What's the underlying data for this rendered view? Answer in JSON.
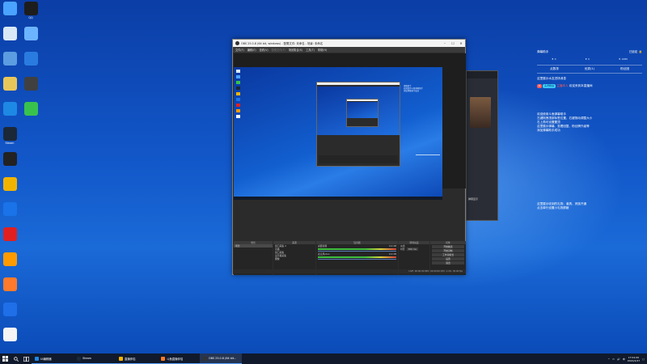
{
  "desktop": {
    "icons": [
      {
        "label": "",
        "icon": "computer-icon",
        "color": "#4aa3ff"
      },
      {
        "label": "QQ",
        "icon": "qq-icon",
        "color": "#1d1d1d"
      },
      {
        "label": "",
        "icon": "recycle-bin-icon",
        "color": "#d9e8f6"
      },
      {
        "label": "",
        "icon": "control-panel-icon",
        "color": "#6bb4ff"
      },
      {
        "label": "",
        "icon": "network-icon",
        "color": "#5b9de0"
      },
      {
        "label": "",
        "icon": "app-icon",
        "color": "#2a7be0"
      },
      {
        "label": "",
        "icon": "folder-icon",
        "color": "#e8c75a"
      },
      {
        "label": "",
        "icon": "media-icon",
        "color": "#404040"
      },
      {
        "label": "",
        "icon": "ie-icon",
        "color": "#1e88e5"
      },
      {
        "label": "",
        "icon": "wechat-icon",
        "color": "#39c14e"
      },
      {
        "label": "Steam",
        "icon": "steam-icon",
        "color": "#1b2838"
      },
      {
        "label": "",
        "icon": "obs-icon",
        "color": "#222222"
      },
      {
        "label": "",
        "icon": "game-icon",
        "color": "#f0b400"
      },
      {
        "label": "",
        "icon": "chrome-icon",
        "color": "#1a73e8"
      },
      {
        "label": "",
        "icon": "netease-music-icon",
        "color": "#e02020"
      },
      {
        "label": "",
        "icon": "huya-icon",
        "color": "#ff9a00"
      },
      {
        "label": "",
        "icon": "douyu-icon",
        "color": "#ff7a2a"
      },
      {
        "label": "",
        "icon": "kugou-icon",
        "color": "#1f6fe8"
      },
      {
        "label": "",
        "icon": "file-icon",
        "color": "#f5f5f5"
      }
    ]
  },
  "obs": {
    "title": "OBS 25.0.8 (64 bit, windows) - 配置文件: 未命名 - 场景: 未命名",
    "menu": [
      {
        "label": "文件(F)",
        "disabled": false
      },
      {
        "label": "编辑(E)",
        "disabled": false
      },
      {
        "label": "查看(V)",
        "disabled": false
      },
      {
        "label": "配置文件(P)",
        "disabled": true
      },
      {
        "label": "场景集合(S)",
        "disabled": false
      },
      {
        "label": "工具(T)",
        "disabled": false
      },
      {
        "label": "帮助(H)",
        "disabled": false
      }
    ],
    "docks": {
      "scenes_title": "场景",
      "scenes": [
        "场景"
      ],
      "sources_title": "来源",
      "sources": [
        "窗口采集 2",
        "直播",
        "窗口采集",
        "显示器采集",
        "图像"
      ],
      "mixer_title": "混音器",
      "mixer": [
        {
          "name": "桌面音频",
          "level": "0.0 dB"
        },
        {
          "name": "麦克风/Aux",
          "level": "0.0 dB"
        }
      ],
      "transitions_title": "转场动画",
      "transition_type": "淡出",
      "duration_label": "时长",
      "duration_value": "300 ms",
      "controls_title": "控件",
      "controls": [
        "开始推流",
        "开始录制",
        "工作室模式",
        "设置",
        "退出"
      ]
    },
    "status": "LIVE: 00:00:00   REC: 00:00:00   CPU: 1.4%, 30.00 fps"
  },
  "overlay": {
    "title": "弹幕助手",
    "lock_status": "已锁定",
    "lock_icon": "lock-icon",
    "stats": [
      "0",
      "0",
      "1680"
    ],
    "tabs": [
      "点数排",
      "优秀(1)",
      "粉丝团"
    ],
    "welcome": "这里展示水友进场消息",
    "badge_level": "8",
    "badge_name": "头号粉丝",
    "badge_user": "主播本人",
    "welcome_suffix": "欢迎来到本直播间",
    "help_lines": [
      "欢迎使用斗鱼弹幕助手",
      "左键拖拽顶部标签位置，右键拖动调整大小",
      "右上角可设置置顶",
      "这里展示弹幕、查看回复、粉丝牌升级等",
      "添加弹幕助手成功"
    ],
    "gift_lines": [
      "这里展示收到的礼物、道具、贵族开通",
      "点击单行设置小礼物屏蔽"
    ]
  },
  "live_panel": {
    "bottom_text": "弹幕显示"
  },
  "taskbar": {
    "start_icon": "windows-start-icon",
    "search_icon": "search-icon",
    "taskview_icon": "task-view-icon",
    "apps": [
      {
        "label": "UI编辑器",
        "icon": "ui-editor-icon",
        "color": "#1e88e5",
        "active": false
      },
      {
        "label": "Steam",
        "icon": "steam-icon",
        "color": "#1b2838",
        "active": false
      },
      {
        "label": "直播伴侣",
        "icon": "live-icon",
        "color": "#ffb300",
        "active": false
      },
      {
        "label": "斗鱼直播伴侣",
        "icon": "douyu-icon",
        "color": "#ff7a2a",
        "active": false
      },
      {
        "label": "OBS 25.0.8 (64 bit...",
        "icon": "obs-icon",
        "color": "#333333",
        "active": true
      }
    ],
    "tray_icons": [
      "up-arrow-icon",
      "network-icon",
      "volume-icon",
      "ime-icon"
    ],
    "ime": "中",
    "time": "17:01:00",
    "date": "2021/2/27"
  }
}
